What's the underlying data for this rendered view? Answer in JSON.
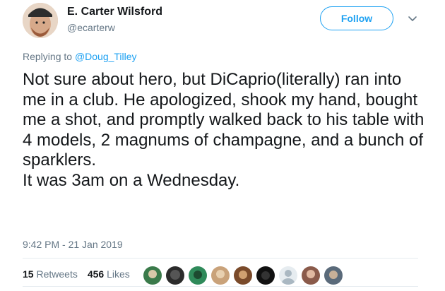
{
  "author": {
    "name": "E. Carter Wilsford",
    "handle": "@ecarterw"
  },
  "actions": {
    "follow_label": "Follow",
    "more_icon": "chevron-down-icon"
  },
  "reply": {
    "prefix": "Replying to ",
    "mention": "@Doug_Tilley"
  },
  "tweet": {
    "text": "Not sure about hero, but DiCaprio(literally) ran into me in a club. He apologized, shook my hand, bought me a shot, and promptly walked back to his table with 4 models, 2 magnums of champagne, and a bunch of sparklers.\nIt was 3am on a Wednesday.",
    "timestamp": "9:42 PM - 21 Jan 2019"
  },
  "stats": {
    "retweets_count": "15",
    "retweets_label": "Retweets",
    "likes_count": "456",
    "likes_label": "Likes"
  },
  "likers": [
    {
      "color": "#3a7a4a"
    },
    {
      "color": "#2b2b2b"
    },
    {
      "color": "#2f8a5a"
    },
    {
      "color": "#c9a27a"
    },
    {
      "color": "#7a4a2a"
    },
    {
      "color": "#111111"
    },
    {
      "color": "#c0c8d0"
    },
    {
      "color": "#8a5a4a"
    },
    {
      "color": "#5a6a7a"
    }
  ]
}
